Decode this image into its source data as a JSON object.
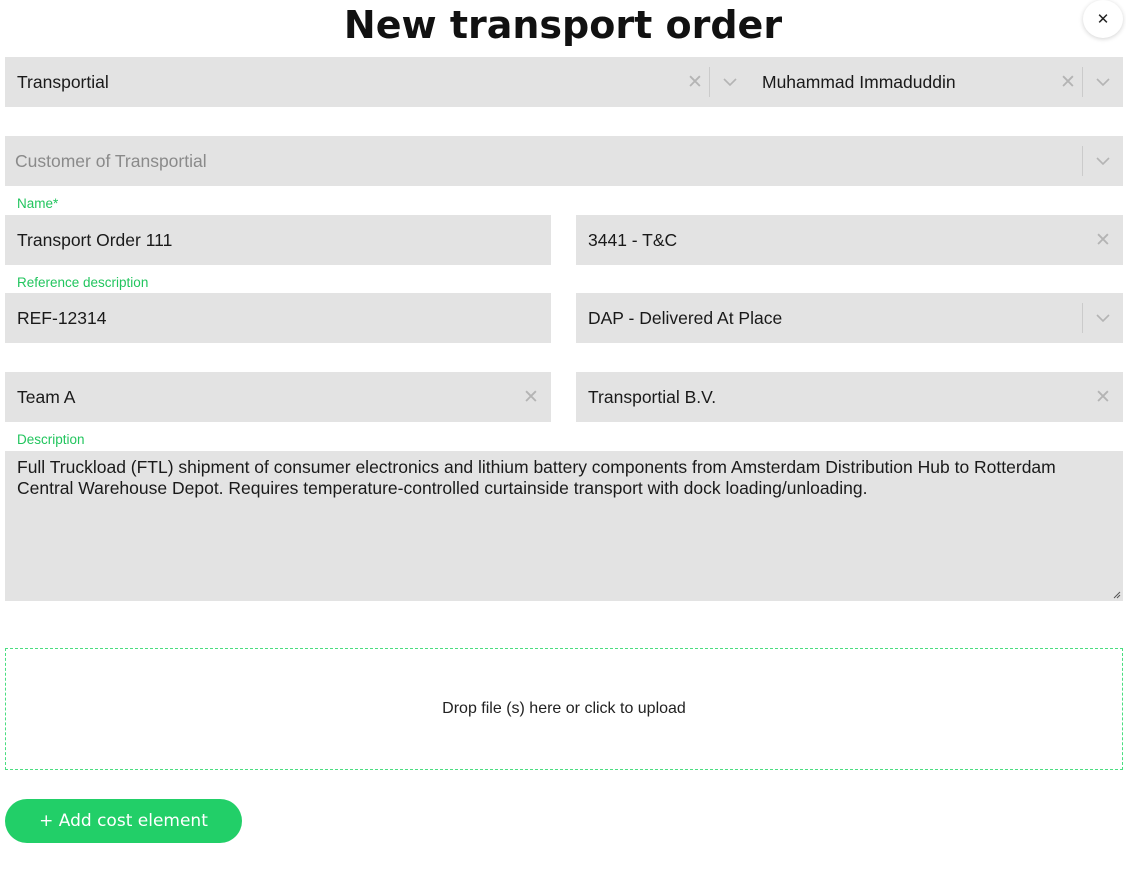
{
  "title": "New transport order",
  "close_icon": "close-icon",
  "row1": {
    "company": "Transportial",
    "contact": "Muhammad Immaduddin"
  },
  "customer": {
    "placeholder": "Customer of Transportial"
  },
  "name": {
    "label": "Name*",
    "value": "Transport Order 111"
  },
  "terms": {
    "value": "3441 - T&C"
  },
  "reference": {
    "label": "Reference description",
    "value": "REF-12314"
  },
  "incoterm": {
    "value": "DAP - Delivered At Place"
  },
  "team": {
    "value": "Team A"
  },
  "carrier": {
    "value": "Transportial B.V."
  },
  "description": {
    "label": "Description",
    "value": "Full Truckload (FTL) shipment of consumer electronics and lithium battery components from Amsterdam Distribution Hub to Rotterdam Central Warehouse Depot. Requires temperature-controlled curtainside transport with dock loading/unloading."
  },
  "upload": {
    "text": "Drop file (s) here or click to upload"
  },
  "actions": {
    "add_cost": "+ Add cost element"
  },
  "colors": {
    "accent": "#22cf68",
    "label_green": "#22c55e",
    "field_bg": "#e3e3e3"
  }
}
